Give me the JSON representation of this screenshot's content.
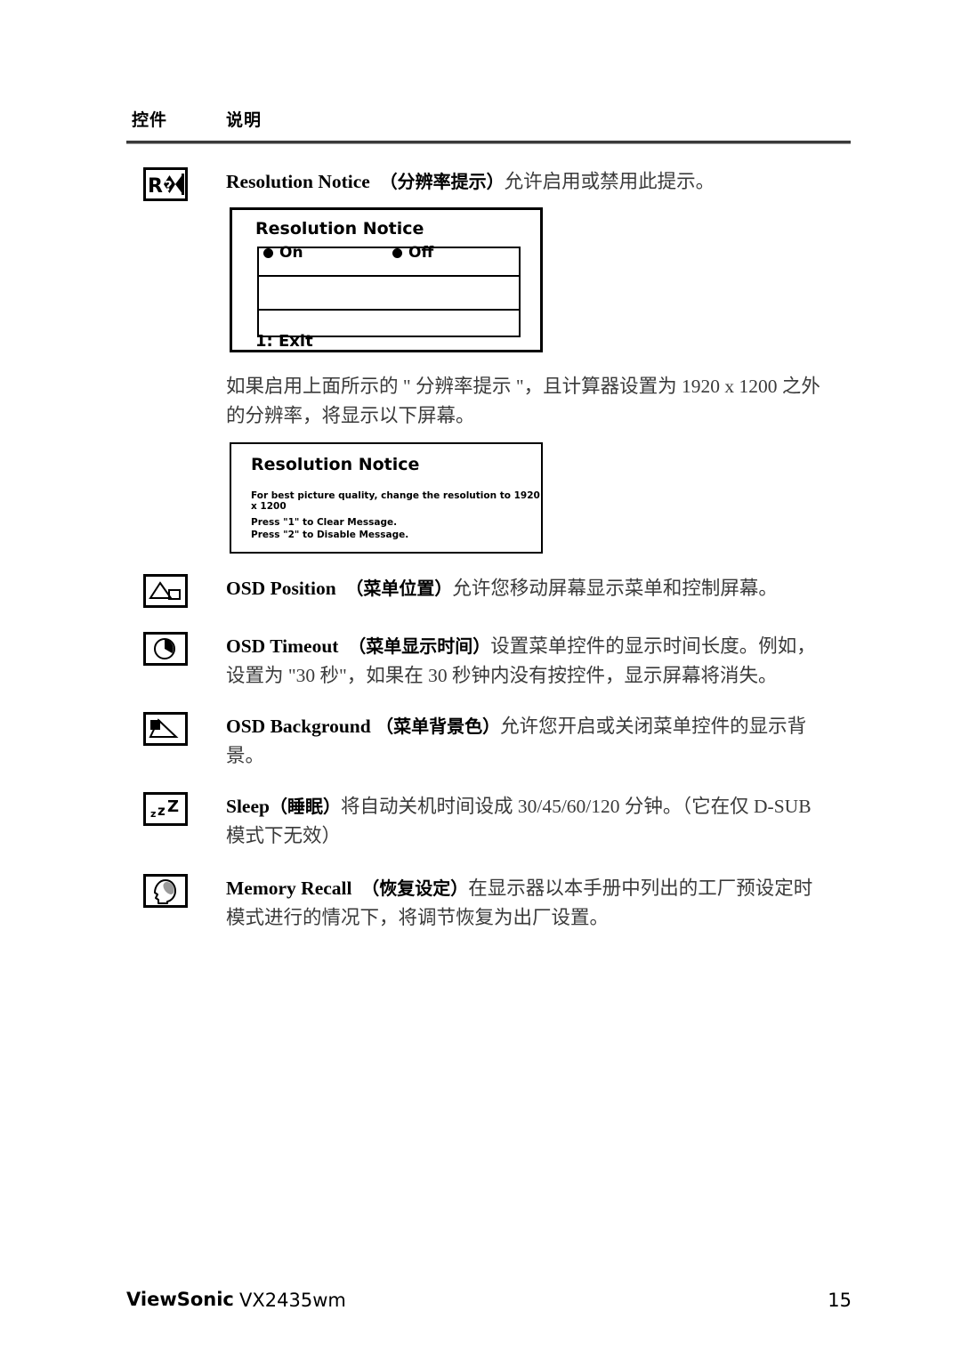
{
  "header": {
    "col_controls": "控件",
    "col_description": "说明"
  },
  "rows": [
    {
      "icon": "resolution-notice-icon",
      "en_label": "Resolution Notice",
      "cn_label": "（分辨率提示）",
      "cn_text": "允许启用或禁用此提示。"
    },
    {
      "icon": "osd-position-icon",
      "en_label": "OSD Position",
      "cn_label": "（菜单位置）",
      "cn_text": "允许您移动屏幕显示菜单和控制屏幕。"
    },
    {
      "icon": "osd-timeout-icon",
      "en_label": "OSD Timeout",
      "cn_label": "（菜单显示时间）",
      "cn_text": "设置菜单控件的显示时间长度。例如，",
      "cn_text2": "设置为 \"30 秒\"，如果在 30 秒钟内没有按控件，显示屏幕将消失。"
    },
    {
      "icon": "osd-background-icon",
      "en_label": "OSD Background",
      "cn_label": "（菜单背景色）",
      "cn_text": "允许您开启或关闭菜单控件的显示背",
      "cn_text2": "景。"
    },
    {
      "icon": "sleep-icon",
      "en_label": "Sleep",
      "cn_label": "（睡眠）",
      "cn_text": "将自动关机时间设成 30/45/60/120 分钟。（它在仅 D-SUB",
      "cn_text2": "模式下无效）"
    },
    {
      "icon": "memory-recall-icon",
      "en_label": "Memory Recall",
      "cn_label": "（恢复设定）",
      "cn_text": "在显示器以本手册中列出的工厂预设定时",
      "cn_text2": "模式进行的情况下，将调节恢复为出厂设置。"
    }
  ],
  "osd_menu": {
    "title": "Resolution Notice",
    "option_on": "On",
    "option_off": "Off",
    "exit_label": "1: Exit"
  },
  "body_note": {
    "line1": "如果启用上面所示的 \" 分辨率提示 \"，且计算器设置为 1920 x 1200 之外",
    "line2": "的分辨率，将显示以下屏幕。"
  },
  "osd_message": {
    "title": "Resolution Notice",
    "line1": "For best picture quality, change the resolution to 1920 x 1200",
    "line2": "Press \"1\" to Clear Message.",
    "line3": "Press \"2\" to Disable Message."
  },
  "footer": {
    "brand": "ViewSonic",
    "model": "VX2435wm",
    "page_number": "15"
  }
}
